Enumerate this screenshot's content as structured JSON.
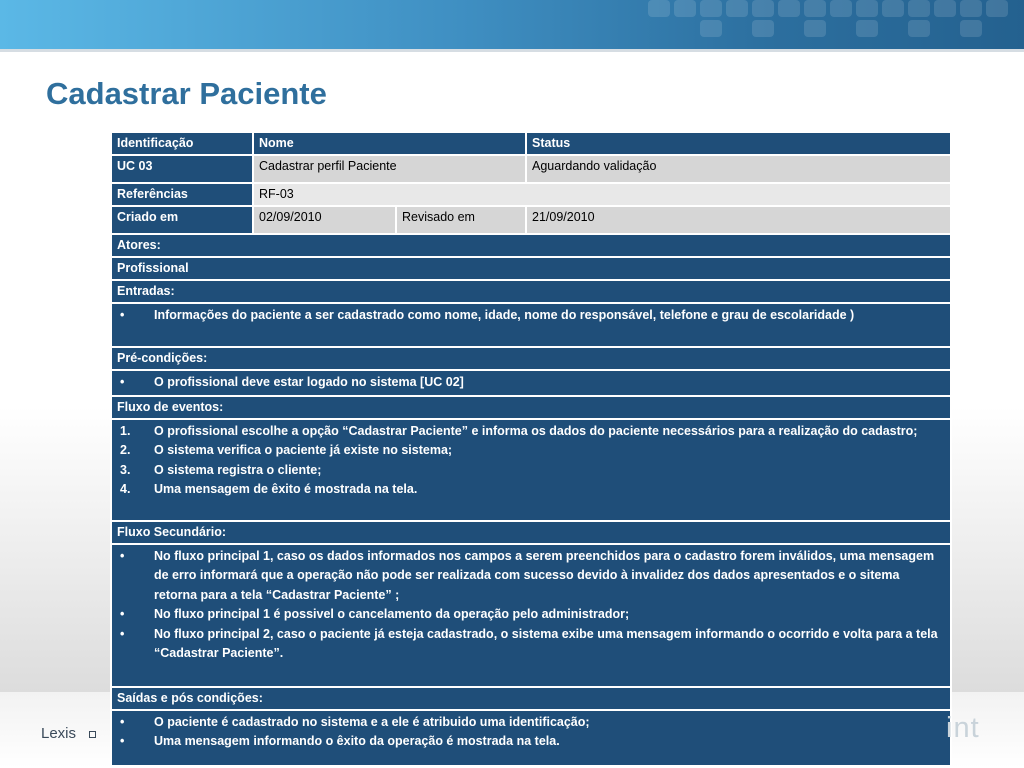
{
  "slide": {
    "title": "Cadastrar Paciente",
    "footer_text": "Lexis",
    "footer_ghost": "int",
    "colors": {
      "accent": "#2f6f9d",
      "table_header": "#1f4e79",
      "cell_value": "#d6d6d6"
    }
  },
  "table": {
    "header": {
      "identificacao": "Identificação",
      "nome": "Nome",
      "status": "Status"
    },
    "row1": {
      "id": "UC 03",
      "nome": "Cadastrar perfil Paciente",
      "status": "Aguardando validação"
    },
    "referencias": {
      "label": "Referências",
      "value": "RF-03"
    },
    "criado": {
      "label": "Criado em",
      "value": "02/09/2010",
      "revisado_label": "Revisado em",
      "revisado_value": "21/09/2010"
    },
    "atores": {
      "label": "Atores:",
      "value": "Profissional"
    },
    "entradas": {
      "label": "Entradas:",
      "items": [
        {
          "marker": "•",
          "text": "Informações do paciente a ser cadastrado como nome,  idade,  nome do responsável, telefone e grau de escolaridade )"
        }
      ]
    },
    "precondicoes": {
      "label": "Pré-condições:",
      "items": [
        {
          "marker": "•",
          "text": "O profissional deve estar logado no sistema [UC 02]"
        }
      ]
    },
    "fluxo": {
      "label": "Fluxo de eventos:",
      "items": [
        {
          "marker": "1.",
          "text": "O profissional escolhe a opção “Cadastrar Paciente” e informa os dados do paciente necessários para a realização do cadastro;"
        },
        {
          "marker": "2.",
          "text": "O sistema verifica o paciente já existe no sistema;"
        },
        {
          "marker": "3.",
          "text": "O sistema registra o cliente;"
        },
        {
          "marker": "4.",
          "text": "Uma mensagem de êxito é mostrada na tela."
        }
      ]
    },
    "fluxo_secundario": {
      "label": "Fluxo Secundário:",
      "items": [
        {
          "marker": "•",
          "text": "No fluxo principal 1, caso os dados informados nos campos a serem preenchidos para o cadastro forem inválidos, uma mensagem de erro informará que a operação não pode ser realizada com sucesso devido à invalidez dos dados apresentados e o sitema retorna para a tela “Cadastrar Paciente” ;"
        },
        {
          "marker": "•",
          "text": "No fluxo principal 1 é possivel o cancelamento da operação pelo administrador;"
        },
        {
          "marker": "•",
          "text": "No fluxo principal 2, caso o paciente já esteja cadastrado, o sistema exibe uma mensagem informando o ocorrido e volta para a tela “Cadastrar Paciente”."
        }
      ]
    },
    "saidas": {
      "label": "Saídas e pós condições:",
      "items": [
        {
          "marker": "•",
          "text": "O paciente é cadastrado no sistema e a ele é atribuido uma identificação;"
        },
        {
          "marker": "•",
          "text": "Uma mensagem informando o  êxito da operação é mostrada na tela."
        }
      ]
    }
  }
}
